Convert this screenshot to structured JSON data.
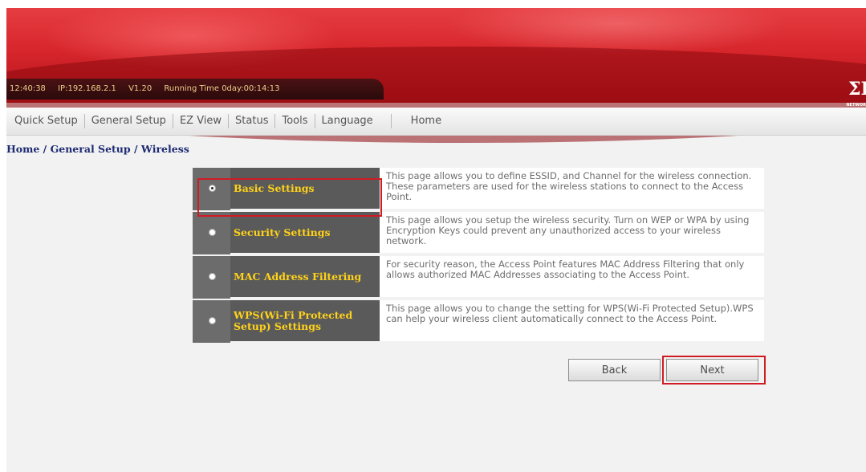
{
  "status": {
    "time": "12:40:38",
    "ip": "IP:192.168.2.1",
    "version": "V1.20",
    "running_time": "Running Time 0day:00:14:13"
  },
  "logo": {
    "symbol": "ΣI",
    "sub": "NETWOR"
  },
  "menu": [
    "Quick Setup",
    "General Setup",
    "EZ View",
    "Status",
    "Tools",
    "Language",
    "Home"
  ],
  "breadcrumb": "Home / General Setup / Wireless",
  "options": [
    {
      "title": "Basic Settings",
      "checked": true,
      "desc": "This page allows you to define ESSID, and Channel for the wireless connection. These parameters are used for the wireless stations to connect to the Access Point."
    },
    {
      "title": "Security Settings",
      "checked": false,
      "desc": "This page allows you setup the wireless security. Turn on WEP or WPA by using Encryption Keys could prevent any unauthorized access to your wireless network."
    },
    {
      "title": "MAC Address Filtering",
      "checked": false,
      "desc": "For security reason, the Access Point features MAC Address Filtering that only allows authorized MAC Addresses associating to the Access Point."
    },
    {
      "title": "WPS(Wi-Fi Protected Setup) Settings",
      "checked": false,
      "desc": "This page allows you to change the setting for WPS(Wi-Fi Protected Setup).WPS can help your wireless client automatically connect to the Access Point."
    }
  ],
  "buttons": {
    "back": "Back",
    "next": "Next"
  },
  "colors": {
    "highlight": "#d11b23",
    "title_text": "#ffd21a",
    "banner": "#d7262c"
  }
}
